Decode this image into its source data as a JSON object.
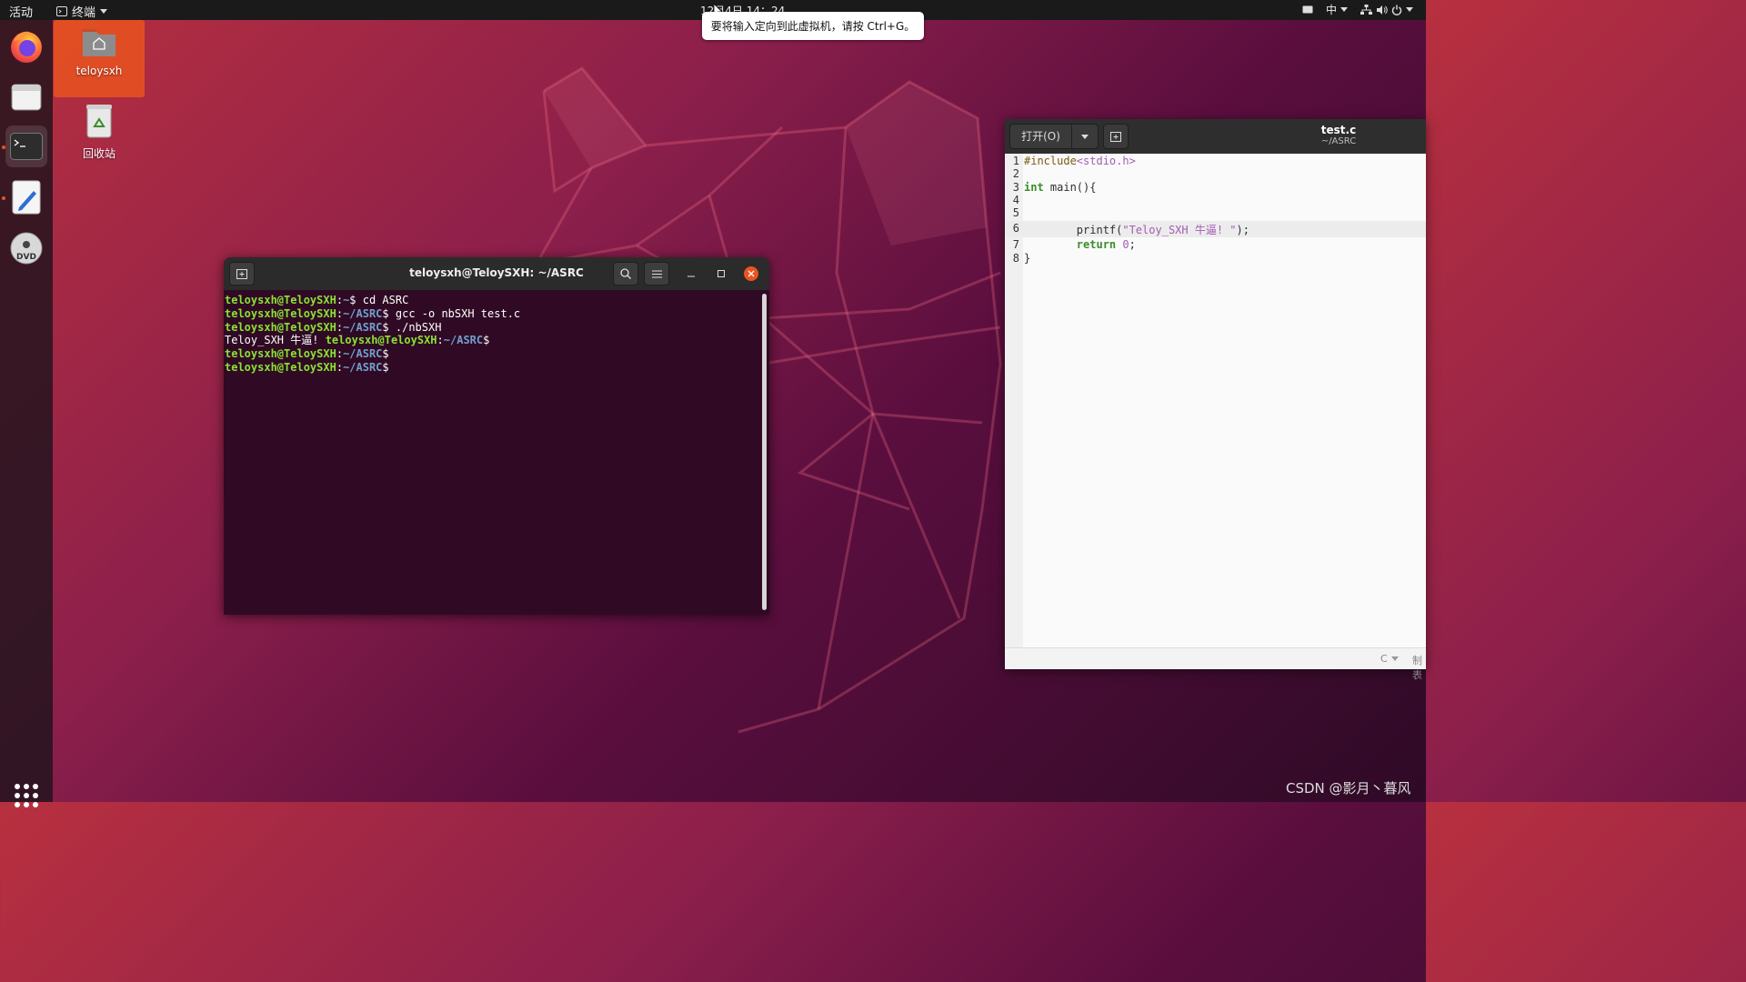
{
  "topbar": {
    "activities": "活动",
    "app_name": "终端",
    "clock": "12月4日  14：24",
    "input_method": "中"
  },
  "tooltip": "要将输入定向到此虚拟机，请按 Ctrl+G。",
  "desktop": {
    "home_label": "teloysxh",
    "trash_label": "回收站"
  },
  "terminal": {
    "title": "teloysxh@TeloySXH: ~/ASRC",
    "lines": [
      {
        "user": "teloysxh@TeloySXH",
        "sep": ":",
        "path": "~",
        "cmd": "$ cd ASRC"
      },
      {
        "user": "teloysxh@TeloySXH",
        "sep": ":",
        "path": "~/ASRC",
        "cmd": "$ gcc -o nbSXH test.c"
      },
      {
        "user": "teloysxh@TeloySXH",
        "sep": ":",
        "path": "~/ASRC",
        "cmd": "$ ./nbSXH"
      },
      {
        "output": "Teloy_SXH 牛逼! ",
        "user": "teloysxh@TeloySXH",
        "sep": ":",
        "path": "~/ASRC",
        "cmd": "$"
      },
      {
        "user": "teloysxh@TeloySXH",
        "sep": ":",
        "path": "~/ASRC",
        "cmd": "$"
      },
      {
        "user": "teloysxh@TeloySXH",
        "sep": ":",
        "path": "~/ASRC",
        "cmd": "$"
      }
    ]
  },
  "gedit": {
    "open_label": "打开(O)",
    "doc_name": "test.c",
    "doc_path": "~/ASRC",
    "language": "C",
    "tab_width": "制表",
    "lines": [
      {
        "n": "1",
        "pre": "#include",
        "inc": "<stdio.h>"
      },
      {
        "n": "2"
      },
      {
        "n": "3",
        "kw": "int",
        "rest": " main(){"
      },
      {
        "n": "4"
      },
      {
        "n": "5"
      },
      {
        "n": "6",
        "indent": "        ",
        "rest": "printf(",
        "str": "\"Teloy_SXH 牛逼! \"",
        "tail": ");"
      },
      {
        "n": "7",
        "indent": "        ",
        "kw": "return",
        "rest": " ",
        "num": "0",
        "tail": ";"
      },
      {
        "n": "8",
        "rest": "}"
      }
    ]
  },
  "watermark": "CSDN @影月丶暮风",
  "colors": {
    "accent": "#e95420",
    "prompt_user": "#8ae234",
    "prompt_path": "#729fcf",
    "terminal_bg": "#300a24"
  }
}
